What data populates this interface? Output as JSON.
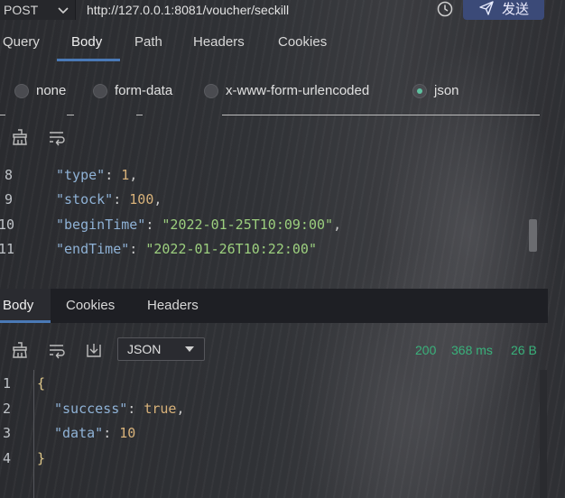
{
  "request": {
    "method": "POST",
    "url": "http://127.0.0.1:8081/voucher/seckill",
    "send_label": "发送",
    "tabs": [
      "Query",
      "Body",
      "Path",
      "Headers",
      "Cookies"
    ],
    "active_tab": "Body",
    "body_types": [
      "none",
      "form-data",
      "x-www-form-urlencoded",
      "json"
    ],
    "selected_body_type": "json",
    "code_lines": [
      {
        "num": "8",
        "key": "\"type\"",
        "value": "1",
        "suffix": ","
      },
      {
        "num": "9",
        "key": "\"stock\"",
        "value": "100",
        "suffix": ","
      },
      {
        "num": "10",
        "key": "\"beginTime\"",
        "value": "\"2022-01-25T10:09:00\"",
        "suffix": ","
      },
      {
        "num": "11",
        "key": "\"endTime\"",
        "value": "\"2022-01-26T10:22:00\"",
        "suffix": ""
      }
    ]
  },
  "response": {
    "tabs": [
      "Body",
      "Cookies",
      "Headers"
    ],
    "active_tab": "Body",
    "format": "JSON",
    "status": "200",
    "time": "368 ms",
    "size": "26 B",
    "lines": [
      {
        "num": "1",
        "text": "{"
      },
      {
        "num": "2",
        "key": "\"success\"",
        "value": "true",
        "suffix": ","
      },
      {
        "num": "3",
        "key": "\"data\"",
        "value": "10",
        "suffix": ""
      },
      {
        "num": "4",
        "text": "}"
      }
    ]
  },
  "icons": [
    "chevron-down-icon",
    "history-icon",
    "send-icon",
    "clear-icon",
    "wrap-icon",
    "download-icon"
  ],
  "colors": {
    "accent": "#4a79b6",
    "send_button": "#3b4a78",
    "status_ok": "#39b27b",
    "json_string": "#9ccf7e",
    "json_key": "#8fb2d6"
  }
}
